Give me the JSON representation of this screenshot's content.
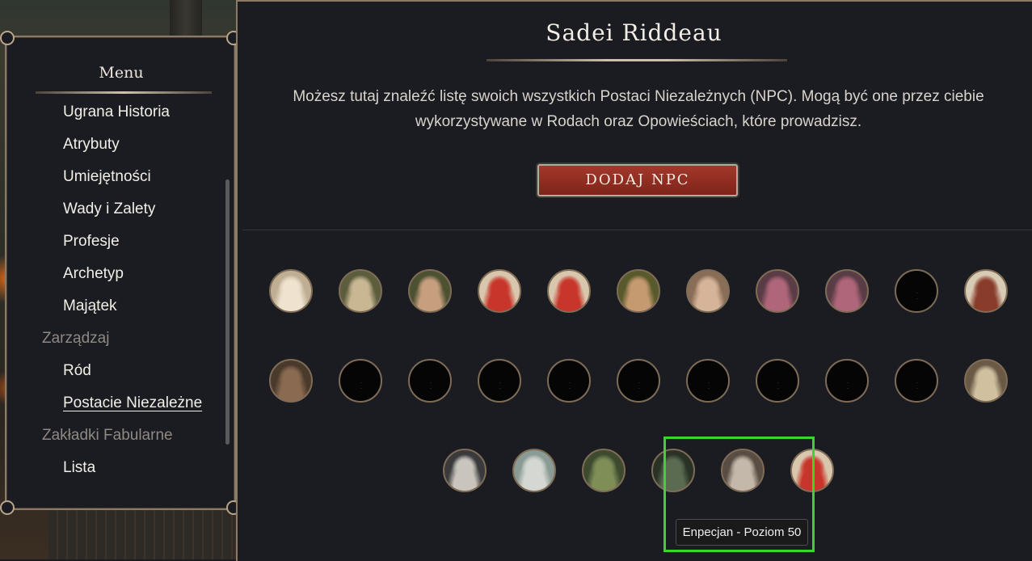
{
  "menu": {
    "title": "Menu",
    "items": [
      {
        "label": "Ugrana Historia",
        "type": "item"
      },
      {
        "label": "Atrybuty",
        "type": "item"
      },
      {
        "label": "Umiejętności",
        "type": "item"
      },
      {
        "label": "Wady i Zalety",
        "type": "item"
      },
      {
        "label": "Profesje",
        "type": "item"
      },
      {
        "label": "Archetyp",
        "type": "item"
      },
      {
        "label": "Majątek",
        "type": "item"
      },
      {
        "label": "Zarządzaj",
        "type": "section"
      },
      {
        "label": "Ród",
        "type": "item"
      },
      {
        "label": "Postacie Niezależne",
        "type": "item",
        "active": true
      },
      {
        "label": "Zakładki Fabularne",
        "type": "section"
      },
      {
        "label": "Lista",
        "type": "item"
      }
    ]
  },
  "main": {
    "title": "Sadei Riddeau",
    "intro_line1": "Możesz tutaj znaleźć listę swoich wszystkich Postaci Niezależnych (NPC). Mogą być one przez ciebie",
    "intro_line2": "wykorzystywane w Rodach oraz Opowieściach, które prowadzisz.",
    "add_button": "DODAJ NPC"
  },
  "npcs": [
    {
      "icon": "crowned-woman-portrait",
      "bg": "#bfae93",
      "fg": "#efe3cf"
    },
    {
      "icon": "bald-elf-portrait",
      "bg": "#5b5d3c",
      "fg": "#c9b793"
    },
    {
      "icon": "woman-portrait",
      "bg": "#4c5131",
      "fg": "#c79f7e"
    },
    {
      "icon": "crab-portrait",
      "bg": "#d9c7ad",
      "fg": "#c8352a"
    },
    {
      "icon": "crab-portrait",
      "bg": "#d9c7ad",
      "fg": "#c8352a"
    },
    {
      "icon": "smiling-woman-portrait",
      "bg": "#595a2b",
      "fg": "#c69a71"
    },
    {
      "icon": "redhead-woman-portrait",
      "bg": "#8a6d56",
      "fg": "#d6b49a"
    },
    {
      "icon": "tentacle-creature-portrait",
      "bg": "#5a3c46",
      "fg": "#b0667a"
    },
    {
      "icon": "tentacle-creature-portrait",
      "bg": "#5a3c46",
      "fg": "#b0667a"
    },
    {
      "icon": "empty-portrait",
      "bg": "#050505",
      "fg": "#050505"
    },
    {
      "icon": "old-warrior-portrait",
      "bg": "#d8cbb4",
      "fg": "#8a3c2c"
    },
    {
      "icon": "hooded-man-portrait",
      "bg": "#4a3a2c",
      "fg": "#8a6a50"
    },
    {
      "icon": "empty-portrait",
      "bg": "#050505",
      "fg": "#050505"
    },
    {
      "icon": "empty-portrait",
      "bg": "#050505",
      "fg": "#050505"
    },
    {
      "icon": "empty-portrait",
      "bg": "#050505",
      "fg": "#050505"
    },
    {
      "icon": "empty-portrait",
      "bg": "#050505",
      "fg": "#050505"
    },
    {
      "icon": "empty-portrait",
      "bg": "#050505",
      "fg": "#050505"
    },
    {
      "icon": "empty-portrait",
      "bg": "#050505",
      "fg": "#050505"
    },
    {
      "icon": "empty-portrait",
      "bg": "#050505",
      "fg": "#050505"
    },
    {
      "icon": "empty-portrait",
      "bg": "#050505",
      "fg": "#050505"
    },
    {
      "icon": "empty-portrait",
      "bg": "#050505",
      "fg": "#050505"
    },
    {
      "icon": "goblin-portrait",
      "bg": "#6a5a45",
      "fg": "#d0c0a0"
    },
    {
      "icon": "white-haired-man-portrait",
      "bg": "#3a3a3c",
      "fg": "#c9c4bd"
    },
    {
      "icon": "elf-warrior-portrait",
      "bg": "#8a9a94",
      "fg": "#d5d8d2"
    },
    {
      "icon": "green-armored-figure-portrait",
      "bg": "#3d4a2e",
      "fg": "#7f8e57"
    },
    {
      "icon": "dark-haired-man-portrait",
      "bg": "#2a3226",
      "fg": "#5a6b52"
    },
    {
      "icon": "grey-haired-old-man-portrait",
      "bg": "#5a4e44",
      "fg": "#c4b8aa"
    },
    {
      "icon": "crab-portrait",
      "bg": "#d9c7ad",
      "fg": "#c8352a"
    }
  ],
  "tooltip": "Enpecjan - Poziom 50",
  "colors": {
    "accent_red": "#8f2d20",
    "highlight_green": "#3bd62b",
    "panel_border": "#8a7a66"
  }
}
